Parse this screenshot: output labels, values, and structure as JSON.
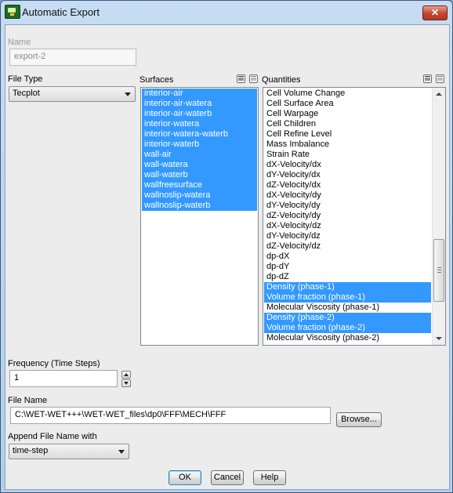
{
  "window": {
    "title": "Automatic Export",
    "close_glyph": "✕"
  },
  "name": {
    "label": "Name",
    "value": "export-2"
  },
  "file_type": {
    "label": "File Type",
    "value": "Tecplot"
  },
  "surfaces": {
    "label": "Surfaces",
    "items": [
      {
        "label": "interior-air",
        "selected": true
      },
      {
        "label": "interior-air-watera",
        "selected": true
      },
      {
        "label": "interior-air-waterb",
        "selected": true
      },
      {
        "label": "interior-watera",
        "selected": true
      },
      {
        "label": "interior-watera-waterb",
        "selected": true
      },
      {
        "label": "interior-waterb",
        "selected": true
      },
      {
        "label": "wall-air",
        "selected": true
      },
      {
        "label": "wall-watera",
        "selected": true
      },
      {
        "label": "wall-waterb",
        "selected": true
      },
      {
        "label": "wallfreesurface",
        "selected": true
      },
      {
        "label": "wallnoslip-watera",
        "selected": true
      },
      {
        "label": "wallnoslip-waterb",
        "selected": true
      }
    ]
  },
  "quantities": {
    "label": "Quantities",
    "scroll_position": 0.82,
    "items": [
      {
        "label": "Cell Volume Change",
        "selected": false
      },
      {
        "label": "Cell Surface Area",
        "selected": false
      },
      {
        "label": "Cell Warpage",
        "selected": false
      },
      {
        "label": "Cell Children",
        "selected": false
      },
      {
        "label": "Cell Refine Level",
        "selected": false
      },
      {
        "label": "Mass Imbalance",
        "selected": false
      },
      {
        "label": "Strain Rate",
        "selected": false
      },
      {
        "label": "dX-Velocity/dx",
        "selected": false
      },
      {
        "label": "dY-Velocity/dx",
        "selected": false
      },
      {
        "label": "dZ-Velocity/dx",
        "selected": false
      },
      {
        "label": "dX-Velocity/dy",
        "selected": false
      },
      {
        "label": "dY-Velocity/dy",
        "selected": false
      },
      {
        "label": "dZ-Velocity/dy",
        "selected": false
      },
      {
        "label": "dX-Velocity/dz",
        "selected": false
      },
      {
        "label": "dY-Velocity/dz",
        "selected": false
      },
      {
        "label": "dZ-Velocity/dz",
        "selected": false
      },
      {
        "label": "dp-dX",
        "selected": false
      },
      {
        "label": "dp-dY",
        "selected": false
      },
      {
        "label": "dp-dZ",
        "selected": false
      },
      {
        "label": "Density (phase-1)",
        "selected": true
      },
      {
        "label": "Volume fraction (phase-1)",
        "selected": true
      },
      {
        "label": "Molecular Viscosity (phase-1)",
        "selected": false
      },
      {
        "label": "Density (phase-2)",
        "selected": true
      },
      {
        "label": "Volume fraction (phase-2)",
        "selected": true
      },
      {
        "label": "Molecular Viscosity (phase-2)",
        "selected": false
      }
    ]
  },
  "frequency": {
    "label": "Frequency (Time Steps)",
    "value": "1"
  },
  "file_name": {
    "label": "File Name",
    "value": "C:\\WET-WET+++\\WET-WET_files\\dp0\\FFF\\MECH\\FFF",
    "browse_label": "Browse..."
  },
  "append": {
    "label": "Append File Name with",
    "value": "time-step"
  },
  "buttons": {
    "ok": "OK",
    "cancel": "Cancel",
    "help": "Help"
  },
  "colors": {
    "selection": "#3399ff",
    "window_frame": "#b3cde9"
  }
}
